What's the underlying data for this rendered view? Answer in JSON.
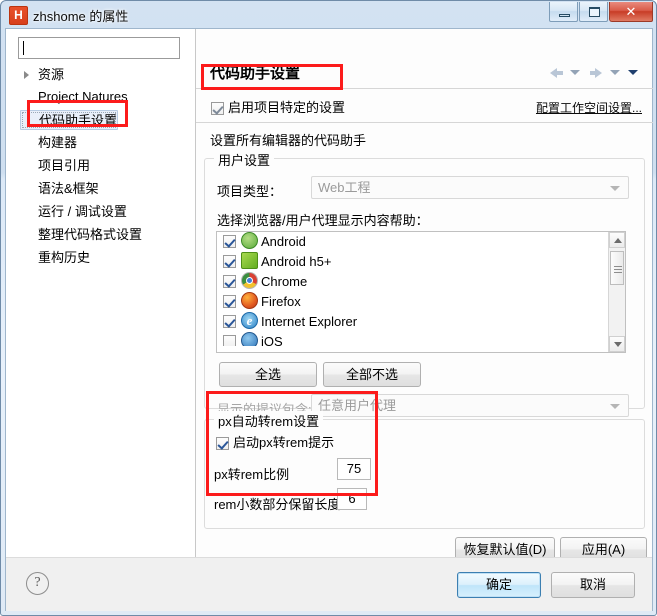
{
  "window": {
    "title": "zhshome 的属性",
    "icon": "hbuilder-h-icon",
    "app_letter": "H",
    "controls": {
      "minimize": "minimize-icon",
      "maximize": "maximize-icon",
      "close": "✕"
    }
  },
  "sidebar": {
    "search": {
      "value": "",
      "placeholder": ""
    },
    "items": [
      {
        "label": "资源",
        "has_arrow": true,
        "selected": false
      },
      {
        "label": "Project Natures",
        "has_arrow": false,
        "selected": false
      },
      {
        "label": "代码助手设置",
        "has_arrow": false,
        "selected": true
      },
      {
        "label": "构建器",
        "has_arrow": false,
        "selected": false
      },
      {
        "label": "项目引用",
        "has_arrow": false,
        "selected": false
      },
      {
        "label": "语法&框架",
        "has_arrow": false,
        "selected": false
      },
      {
        "label": "运行 / 调试设置",
        "has_arrow": false,
        "selected": false
      },
      {
        "label": "整理代码格式设置",
        "has_arrow": false,
        "selected": false
      },
      {
        "label": "重构历史",
        "has_arrow": false,
        "selected": false
      }
    ]
  },
  "main": {
    "title": "代码助手设置",
    "nav": {
      "back": "arrow-left-icon",
      "back_menu": "chevron-down-icon",
      "forward": "arrow-right-icon",
      "forward_menu": "chevron-down-icon",
      "more_menu": "chevron-down-icon"
    },
    "enable_project_specific": {
      "label": "启用项目特定的设置",
      "checked": true
    },
    "workspace_link": "配置工作空间设置...",
    "section_label": "设置所有编辑器的代码助手",
    "user_settings_group": {
      "legend": "用户设置",
      "project_type_label": "项目类型：",
      "project_type_value": "Web工程",
      "browser_list_label": "选择浏览器/用户代理显示内容帮助：",
      "browsers": [
        {
          "name": "Android",
          "icon": "android-icon",
          "checked": true
        },
        {
          "name": "Android h5+",
          "icon": "android-h5-icon",
          "checked": true
        },
        {
          "name": "Chrome",
          "icon": "chrome-icon",
          "checked": true
        },
        {
          "name": "Firefox",
          "icon": "firefox-icon",
          "checked": true
        },
        {
          "name": "Internet Explorer",
          "icon": "internet-explorer-icon",
          "checked": true
        },
        {
          "name": "iOS",
          "icon": "ios-icon",
          "checked": false
        }
      ],
      "select_all_label": "全选",
      "select_none_label": "全部不选",
      "proposals_label": "显示的提议包含:",
      "proposals_value": "任意用户代理"
    },
    "pxrem_group": {
      "legend": "px自动转rem设置",
      "enable_label": "启动px转rem提示",
      "enable_checked": true,
      "ratio_label": "px转rem比例",
      "ratio_value": "75",
      "decimal_label": "rem小数部分保留长度",
      "decimal_value": "6"
    },
    "restore_defaults_label": "恢复默认值(D)",
    "apply_label": "应用(A)"
  },
  "footer": {
    "help": "?",
    "ok_label": "确定",
    "cancel_label": "取消"
  },
  "annotations": {
    "color": "#fc1b1b",
    "boxes": [
      "sidebar-code-assist-item",
      "enable-project-specific-checkbox",
      "pxrem-settings-group"
    ]
  }
}
